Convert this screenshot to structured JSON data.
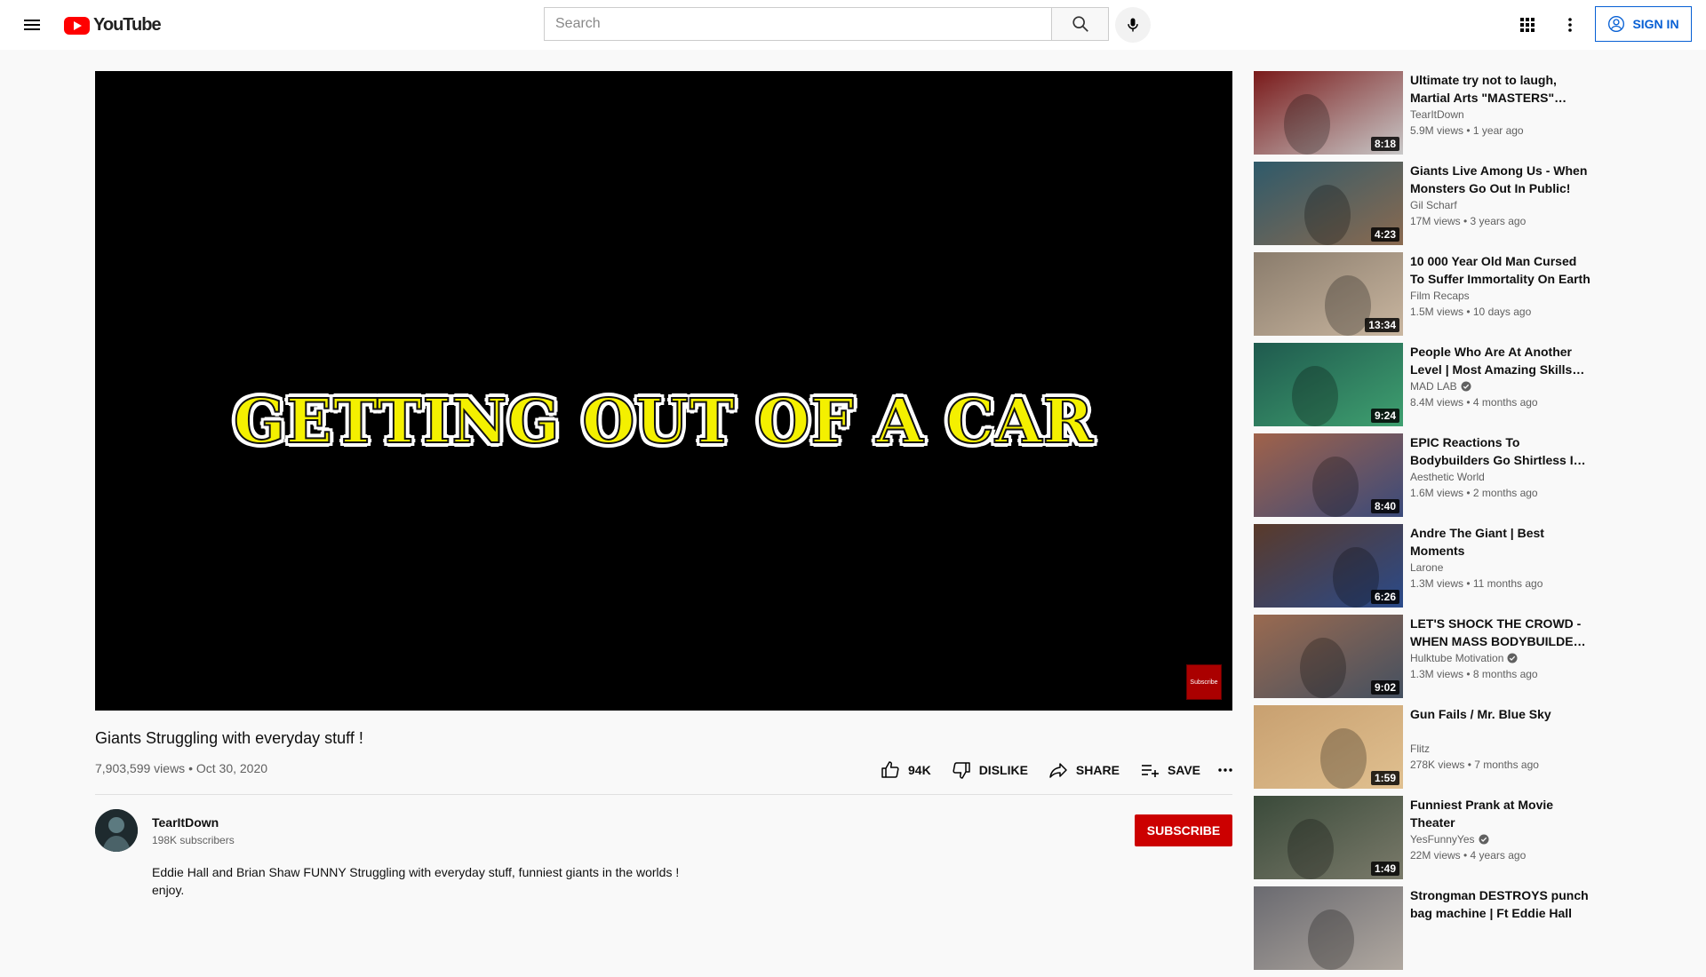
{
  "header": {
    "logo_text": "YouTube",
    "search_placeholder": "Search",
    "signin_label": "SIGN IN"
  },
  "player": {
    "overlay_text": "GETTING OUT OF A CAR",
    "watermark_text": "Subscribe"
  },
  "video": {
    "title": "Giants Struggling with everyday stuff !",
    "meta": "7,903,599 views • Oct 30, 2020",
    "like_count": "94K",
    "dislike_label": "DISLIKE",
    "share_label": "SHARE",
    "save_label": "SAVE"
  },
  "channel": {
    "name": "TearItDown",
    "subscribers": "198K subscribers",
    "subscribe_label": "SUBSCRIBE"
  },
  "description": {
    "line1": "Eddie Hall and Brian Shaw FUNNY Struggling with everyday stuff, funniest giants in the worlds !",
    "line2": "enjoy."
  },
  "recommendations": [
    {
      "title": "Ultimate try not to laugh, Martial Arts \"MASTERS\" edition",
      "channel": "TearItDown",
      "verified": false,
      "stats": "5.9M views • 1 year ago",
      "duration": "8:18",
      "colors": [
        "#7a1a1a",
        "#c8c8c8"
      ]
    },
    {
      "title": "Giants Live Among Us - When Monsters Go Out In Public!",
      "channel": "Gil Scharf",
      "verified": false,
      "stats": "17M views • 3 years ago",
      "duration": "4:23",
      "colors": [
        "#2f5a6a",
        "#8a6a50"
      ]
    },
    {
      "title": "10 000 Year Old Man Cursed To Suffer Immortality On Earth",
      "channel": "Film Recaps",
      "verified": false,
      "stats": "1.5M views • 10 days ago",
      "duration": "13:34",
      "colors": [
        "#8a7c6c",
        "#c9b6a0"
      ]
    },
    {
      "title": "People Who Are At Another Level | Most Amazing Skills And Talents",
      "channel": "MAD LAB",
      "verified": true,
      "stats": "8.4M views • 4 months ago",
      "duration": "9:24",
      "colors": [
        "#1f5a4e",
        "#3fa070"
      ]
    },
    {
      "title": "EPIC Reactions To Bodybuilders Go Shirtless In Public 😱",
      "channel": "Aesthetic World",
      "verified": false,
      "stats": "1.6M views • 2 months ago",
      "duration": "8:40",
      "colors": [
        "#a0624a",
        "#3a4a7a"
      ]
    },
    {
      "title": "Andre The Giant | Best Moments",
      "channel": "Larone",
      "verified": false,
      "stats": "1.3M views • 11 months ago",
      "duration": "6:26",
      "colors": [
        "#5a3a2a",
        "#2a4a8a"
      ]
    },
    {
      "title": "LET'S SHOCK THE CROWD - WHEN MASS BODYBUILDERS GO SHIRTLESS",
      "channel": "Hulktube Motivation",
      "verified": true,
      "stats": "1.3M views • 8 months ago",
      "duration": "9:02",
      "colors": [
        "#9a6a50",
        "#445060"
      ]
    },
    {
      "title": "Gun Fails / Mr. Blue Sky",
      "channel": "Flitz",
      "verified": false,
      "stats": "278K views • 7 months ago",
      "duration": "1:59",
      "colors": [
        "#c8a070",
        "#e0c090"
      ]
    },
    {
      "title": "Funniest Prank at Movie Theater",
      "channel": "YesFunnyYes",
      "verified": true,
      "stats": "22M views • 4 years ago",
      "duration": "1:49",
      "colors": [
        "#3a4a3a",
        "#7a7a6a"
      ]
    },
    {
      "title": "Strongman DESTROYS punch bag machine | Ft Eddie Hall",
      "channel": "",
      "verified": false,
      "stats": "",
      "duration": "",
      "colors": [
        "#6a6a70",
        "#b0a8a0"
      ]
    }
  ]
}
